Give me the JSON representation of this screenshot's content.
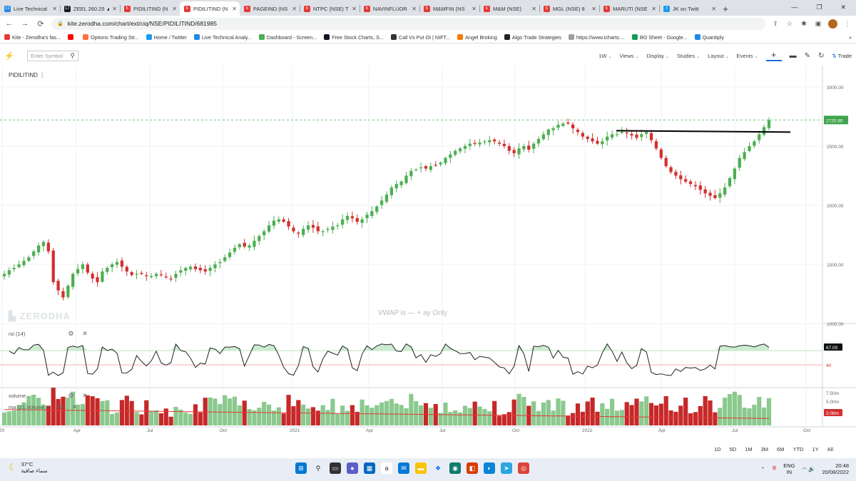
{
  "browser": {
    "tabs": [
      {
        "label": "Live Technical",
        "fav": "#1e88e5",
        "ftext": "c1"
      },
      {
        "label": "ZEEL 260.25 ▲",
        "fav": "#131722",
        "ftext": "17"
      },
      {
        "label": "PIDILITIND (N",
        "fav": "#e53935",
        "ftext": "k"
      },
      {
        "label": "PIDILITIND (N",
        "fav": "#e53935",
        "ftext": "k"
      },
      {
        "label": "PAGEIND (NS",
        "fav": "#e53935",
        "ftext": "k"
      },
      {
        "label": "NTPC (NSE) T",
        "fav": "#e53935",
        "ftext": "k"
      },
      {
        "label": "NAVINFLUOR",
        "fav": "#e53935",
        "ftext": "k"
      },
      {
        "label": "M&MFIN (NS",
        "fav": "#e53935",
        "ftext": "k"
      },
      {
        "label": "M&M (NSE)",
        "fav": "#e53935",
        "ftext": "k"
      },
      {
        "label": "MGL (NSE) 8",
        "fav": "#e53935",
        "ftext": "k"
      },
      {
        "label": "MARUTI (NSE",
        "fav": "#e53935",
        "ftext": "k"
      },
      {
        "label": "JK on Twitt",
        "fav": "#1d9bf0",
        "ftext": "t"
      }
    ],
    "active_tab": 3,
    "url": "kite.zerodha.com/chart/ext/ciq/NSE/PIDILITIND/681985",
    "bookmarks": [
      {
        "label": "Kite - Zerodha's fas...",
        "color": "#e53935"
      },
      {
        "label": "",
        "color": "#ff0000"
      },
      {
        "label": "Options Trading Str...",
        "color": "#ff7043"
      },
      {
        "label": "Home / Twitter",
        "color": "#1d9bf0"
      },
      {
        "label": "Live Technical Analy...",
        "color": "#1e88e5"
      },
      {
        "label": "Dashboard - Screen...",
        "color": "#4caf50"
      },
      {
        "label": "Free Stock Charts, S...",
        "color": "#131722"
      },
      {
        "label": "Call Vs Put OI | NIFT...",
        "color": "#333333"
      },
      {
        "label": "Angel Broking",
        "color": "#f57c00"
      },
      {
        "label": "Algo Trade Strategies",
        "color": "#222222"
      },
      {
        "label": "https://www.icharts....",
        "color": "#9e9e9e"
      },
      {
        "label": "BO Sheet - Google...",
        "color": "#0f9d58"
      },
      {
        "label": "Quantiply",
        "color": "#1e88e5"
      }
    ]
  },
  "toolbar": {
    "symbol_placeholder": "Enter Symbol",
    "interval": "1W",
    "menus": [
      "Views",
      "Display",
      "Studies",
      "Layout",
      "Events"
    ],
    "trade_label": "Trade"
  },
  "chart": {
    "symbol": "PIDILITIND",
    "watermark": "ZERODHA",
    "vwap_note": "VWAP is — + ay Only",
    "price_labels": [
      "3000.00",
      "2500.00",
      "2000.00",
      "1500.00",
      "1000.00"
    ],
    "last_price": "2720.80",
    "x_labels": [
      "20",
      "Apr",
      "Jul",
      "Oct",
      "2021",
      "Apr",
      "Jul",
      "Oct",
      "2022",
      "Apr",
      "Jul",
      "Oct"
    ],
    "rsi_label": "rsi (14)",
    "rsi_value": "67.00",
    "rsi_level": "40",
    "volume_label": "volume",
    "volume_ma_label": "ma (21,Volume,e",
    "volume_labels": [
      "7.50m",
      "5.00m"
    ],
    "volume_last": "2.08m",
    "ranges": [
      "1D",
      "5D",
      "1M",
      "3M",
      "6M",
      "YTD",
      "1Y",
      "All"
    ]
  },
  "chart_data": {
    "type": "candlestick",
    "title": "PIDILITIND",
    "interval": "1W",
    "ylim": [
      1000,
      3000
    ],
    "last_price": 2720.8,
    "resistance_line": 2630,
    "weekly_closes": [
      1420,
      1450,
      1470,
      1500,
      1530,
      1560,
      1610,
      1660,
      1690,
      1610,
      1350,
      1280,
      1220,
      1320,
      1420,
      1460,
      1500,
      1430,
      1380,
      1350,
      1440,
      1470,
      1500,
      1520,
      1480,
      1440,
      1410,
      1420,
      1420,
      1400,
      1400,
      1420,
      1410,
      1390,
      1380,
      1420,
      1450,
      1470,
      1480,
      1460,
      1450,
      1440,
      1470,
      1500,
      1520,
      1560,
      1600,
      1640,
      1670,
      1650,
      1660,
      1700,
      1740,
      1780,
      1830,
      1870,
      1880,
      1860,
      1820,
      1780,
      1760,
      1800,
      1830,
      1810,
      1780,
      1780,
      1800,
      1820,
      1830,
      1880,
      1910,
      1890,
      1860,
      1880,
      1920,
      1950,
      1990,
      2040,
      2090,
      2150,
      2180,
      2200,
      2250,
      2290,
      2300,
      2320,
      2310,
      2330,
      2340,
      2360,
      2400,
      2430,
      2460,
      2480,
      2500,
      2520,
      2520,
      2530,
      2540,
      2550,
      2540,
      2520,
      2500,
      2460,
      2440,
      2480,
      2500,
      2470,
      2520,
      2560,
      2600,
      2640,
      2650,
      2680,
      2690,
      2690,
      2650,
      2620,
      2580,
      2560,
      2540,
      2520,
      2540,
      2580,
      2600,
      2600,
      2620,
      2610,
      2590,
      2570,
      2600,
      2620,
      2550,
      2480,
      2400,
      2330,
      2280,
      2250,
      2220,
      2200,
      2180,
      2160,
      2130,
      2100,
      2080,
      2060,
      2100,
      2150,
      2230,
      2310,
      2400,
      2450,
      2500,
      2540,
      2600,
      2660,
      2720
    ]
  },
  "taskbar": {
    "temp": "37°C",
    "weather": "سماء صافية",
    "lang": "ENG",
    "region": "IN",
    "time": "20:48",
    "date": "20/08/2022"
  }
}
